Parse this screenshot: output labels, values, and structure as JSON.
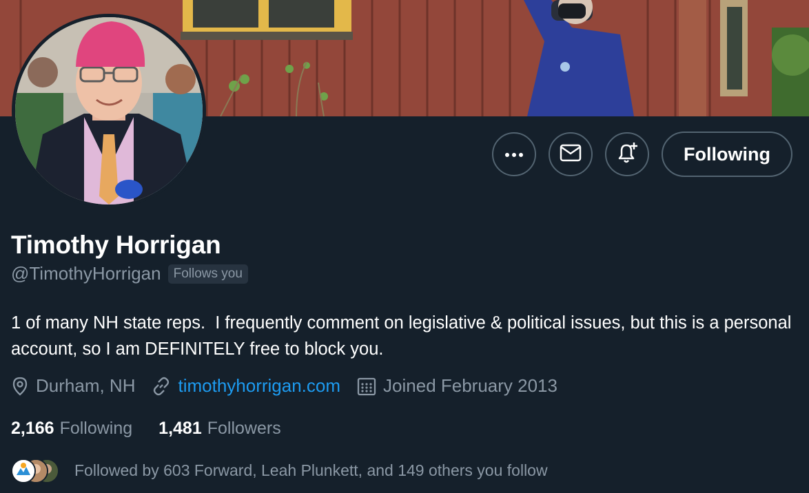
{
  "profile": {
    "display_name": "Timothy Horrigan",
    "handle": "@TimothyHorrigan",
    "follows_you_badge": "Follows you",
    "bio": "1 of many NH state reps.  I frequently comment on legislative & political issues, but this is a personal account, so I am DEFINITELY free to block you.",
    "location": "Durham, NH",
    "website": "timothyhorrigan.com",
    "joined": "Joined February 2013"
  },
  "actions": {
    "more_icon": "more-icon",
    "message_icon": "envelope-icon",
    "notify_icon": "bell-plus-icon",
    "following_label": "Following"
  },
  "stats": {
    "following_count": "2,166",
    "following_label": "Following",
    "followers_count": "1,481",
    "followers_label": "Followers"
  },
  "followed_by": {
    "text": "Followed by 603 Forward, Leah Plunkett, and 149 others you follow"
  },
  "colors": {
    "background": "#15202b",
    "accent_link": "#1d9bf0",
    "secondary_text": "#8b98a5",
    "border": "#536471"
  }
}
